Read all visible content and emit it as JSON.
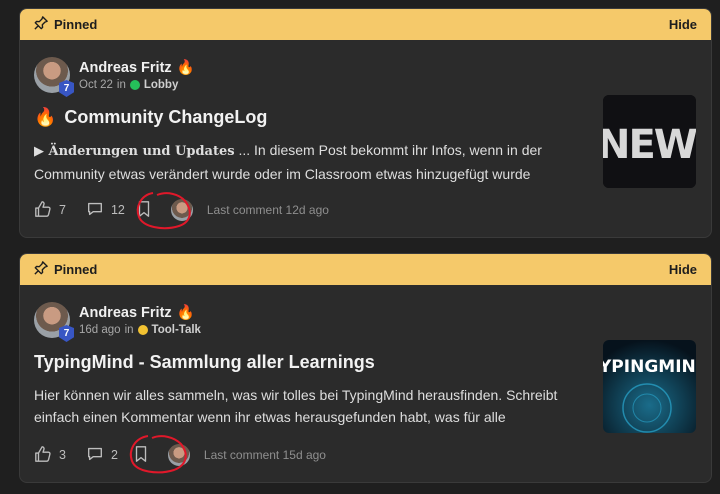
{
  "posts": [
    {
      "pinned_label": "Pinned",
      "hide_label": "Hide",
      "author": "Andreas Fritz",
      "level": "7",
      "date": "Oct 22",
      "in_word": "in",
      "category": "Lobby",
      "category_color": "#25c05a",
      "title": "Community ChangeLog",
      "excerpt_bold": "▶ Änderungen und Updates",
      "excerpt_text": " ... In diesem Post bekommt ihr Infos, wenn in der Community etwas verändert wurde oder im Classroom etwas hinzugefügt wurde",
      "likes": "7",
      "comments": "12",
      "last_comment": "Last comment 12d ago",
      "thumb_text": "NEWS"
    },
    {
      "pinned_label": "Pinned",
      "hide_label": "Hide",
      "author": "Andreas Fritz",
      "level": "7",
      "date": "16d ago",
      "in_word": "in",
      "category": "Tool-Talk",
      "category_color": "#f2c232",
      "title": "TypingMind - Sammlung aller Learnings",
      "excerpt_text": "Hier können wir alles sammeln, was wir tolles bei TypingMind herausfinden. Schreibt einfach einen Kommentar wenn ihr etwas herausgefunden habt, was für alle",
      "likes": "3",
      "comments": "2",
      "last_comment": "Last comment 15d ago",
      "thumb_text": "YPINGMIN"
    }
  ]
}
